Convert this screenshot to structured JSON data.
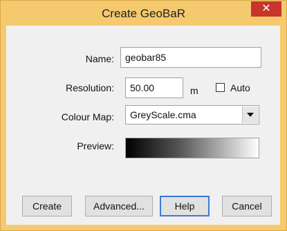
{
  "window": {
    "title": "Create GeoBaR",
    "close_label": "✕"
  },
  "form": {
    "name_label": "Name:",
    "name_value": "geobar85",
    "resolution_label": "Resolution:",
    "resolution_value": "50.00",
    "resolution_unit": "m",
    "auto_label": "Auto",
    "auto_checked": false,
    "colour_map_label": "Colour Map:",
    "colour_map_value": "GreyScale.cma",
    "preview_label": "Preview:"
  },
  "buttons": {
    "create": "Create",
    "advanced": "Advanced...",
    "help": "Help",
    "cancel": "Cancel"
  }
}
